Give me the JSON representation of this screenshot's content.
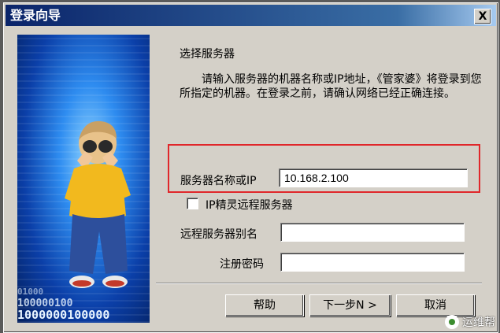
{
  "window": {
    "title": "登录向导",
    "close_label": "X"
  },
  "banner": {
    "binary_lines": [
      "01000",
      "100000100",
      "1000000100000"
    ]
  },
  "content": {
    "heading": "选择服务器",
    "description": "请输入服务器的机器名称或IP地址，《管家婆》将登录到您所指定的机器。在登录之前，请确认网络已经正确连接。"
  },
  "form": {
    "server_label": "服务器名称或IP",
    "server_value": "10.168.2.100",
    "remote_checkbox_label": "IP精灵远程服务器",
    "remote_checkbox_checked": false,
    "remote_alias_label": "远程服务器别名",
    "remote_alias_value": "",
    "reg_password_label": "注册密码",
    "reg_password_value": ""
  },
  "buttons": {
    "help": "帮助",
    "next": "下一步N >",
    "cancel": "取消"
  },
  "watermark": {
    "text": "运维帮"
  },
  "colors": {
    "highlight_box": "#e0272b",
    "titlebar": "#0a246a",
    "dialog_bg": "#d4d0c8"
  }
}
